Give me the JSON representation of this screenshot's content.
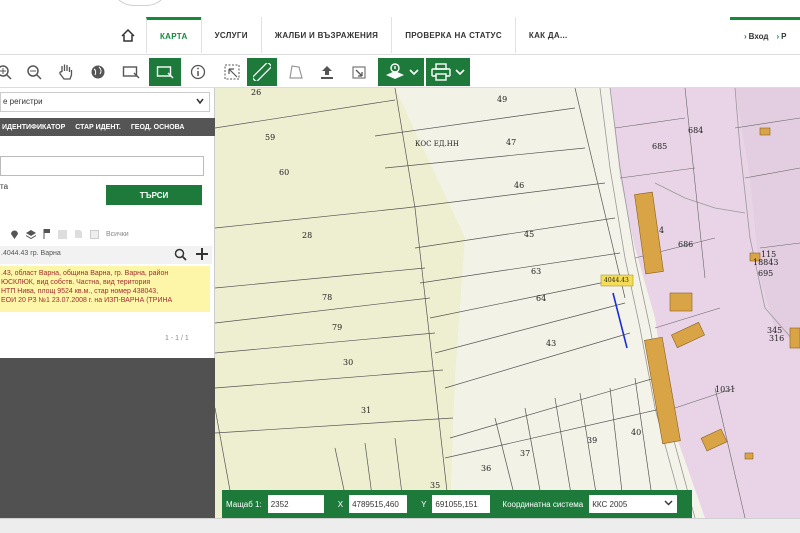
{
  "nav": {
    "items": [
      {
        "label": "КАРТА",
        "active": true
      },
      {
        "label": "УСЛУГИ"
      },
      {
        "label": "ЖАЛБИ И ВЪЗРАЖЕНИЯ"
      },
      {
        "label": "ПРОВЕРКА НА СТАТУС"
      },
      {
        "label": "КАК ДА..."
      }
    ],
    "login": "Вход",
    "register": "Р"
  },
  "toolbar": {
    "icons": [
      "zoom-in-icon",
      "zoom-out-icon",
      "pan-hand-icon",
      "globe-icon",
      "select-rectangle-icon",
      "select-rectangle-active-icon",
      "info-icon",
      "grid-select-icon",
      "ruler-icon",
      "polygon-measure-icon",
      "upload-icon",
      "download-icon",
      "layers-icon",
      "print-icon"
    ]
  },
  "left_panel": {
    "registry_select": "е регистри",
    "search_tabs": [
      "ИДЕНТИФИКАТОР",
      "СТАР ИДЕНТ.",
      "ГЕОД. ОСНОВА"
    ],
    "hint": "та",
    "search_button": "ТЪРСИ",
    "mini_label": "Всички",
    "result_header": ".4044.43 гр. Варна",
    "result_lines": [
      ".43, област Варна, община Варна, гр. Варна, район",
      "ЮСКЛЮК, вид собств. Частна, вид територия",
      "НТП Нива, площ 9524 кв.м., стар номер 438043,",
      "ЕОИ 20 РЗ №1 23.07.2008 г. на ИЗП-ВАРНА (ТРИНА"
    ],
    "pagination": "1 - 1 / 1"
  },
  "map": {
    "parcel_labels": [
      "26",
      "59",
      "60",
      "28",
      "78",
      "79",
      "30",
      "31",
      "49",
      "47",
      "46",
      "45",
      "63",
      "64",
      "43",
      "37",
      "39",
      "40",
      "36",
      "35",
      "685",
      "684",
      "686",
      "1031",
      "18843",
      "695",
      "345",
      "316",
      "115",
      "4"
    ],
    "road_label": "КОС ЕД.НН",
    "marker_label": "4044.43"
  },
  "coords": {
    "scale_label": "Мащаб 1:",
    "scale_value": "2352",
    "x_label": "X",
    "x_value": "4789515,460",
    "y_label": "Y",
    "y_value": "691055,151",
    "system_label": "Координатна система",
    "system_value": "ККС 2005"
  },
  "colors": {
    "accent": "#1d7a3b",
    "nav_active": "#148a3c",
    "parcel_fill": "#eeefd1",
    "urban_fill": "#e8d4e6",
    "building_fill": "#d9a445",
    "highlight": "#fdf6a8"
  }
}
